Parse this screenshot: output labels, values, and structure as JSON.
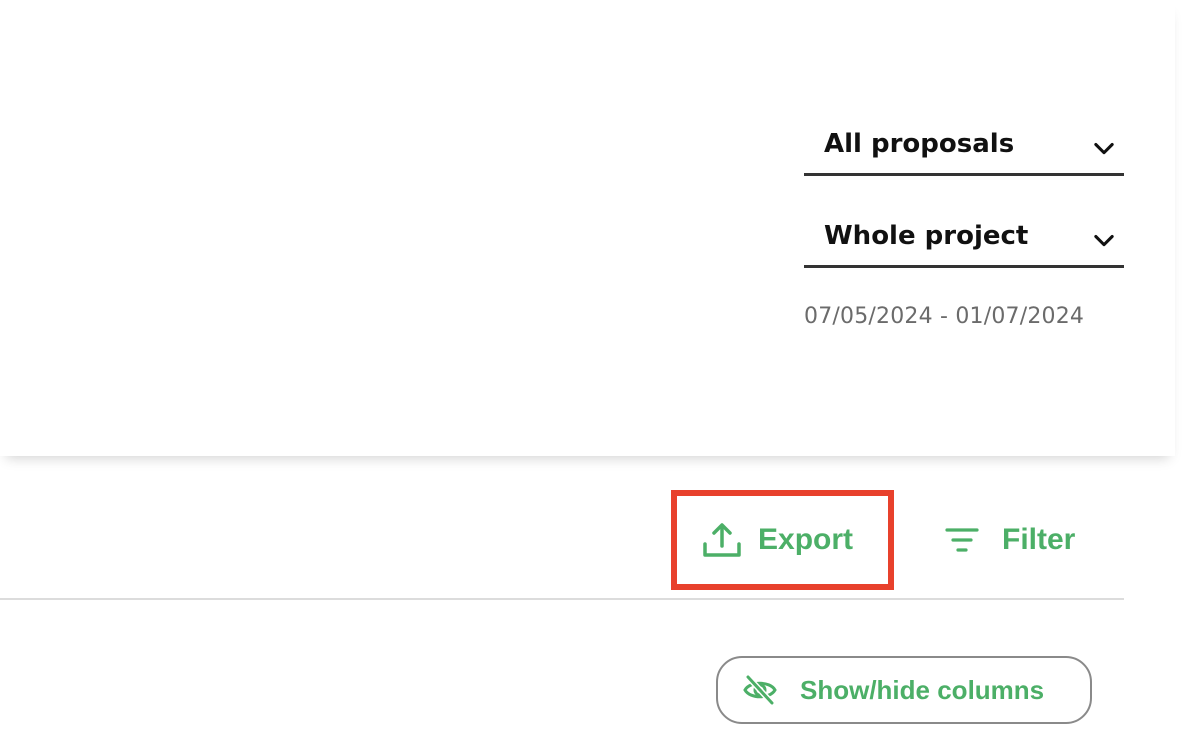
{
  "filters": {
    "proposal_select": {
      "value": "All proposals"
    },
    "period_select": {
      "value": "Whole project"
    },
    "date_range": "07/05/2024 - 01/07/2024"
  },
  "toolbar": {
    "export_label": "Export",
    "filter_label": "Filter",
    "show_hide_columns_label": "Show/hide columns"
  },
  "icons": {
    "export": "upload-icon",
    "filter": "filter-lines-icon",
    "show_hide": "eye-off-icon",
    "select": "chevron-down-icon"
  },
  "colors": {
    "accent": "#4caf67",
    "highlight": "#e8412c",
    "select_text": "#111111",
    "muted_text": "#6b6b6b"
  }
}
